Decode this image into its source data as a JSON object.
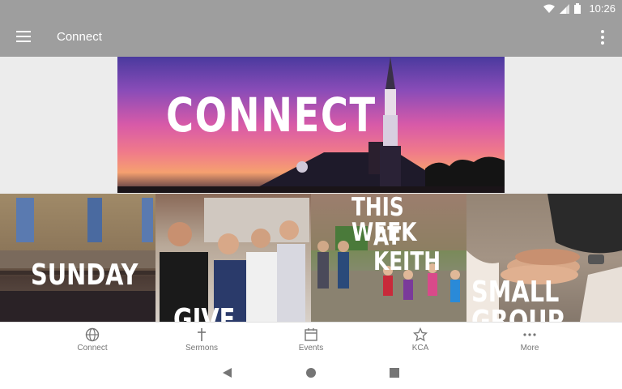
{
  "status_bar": {
    "time": "10:26",
    "icons": [
      "wifi-icon",
      "cell-signal-icon",
      "battery-icon"
    ]
  },
  "app_bar": {
    "title": "Connect",
    "left_icon": "menu-icon",
    "right_icon": "overflow-menu-icon"
  },
  "banner": {
    "title": "CONNECT"
  },
  "tiles": [
    {
      "label": "SUNDAY"
    },
    {
      "label": "GIVE"
    },
    {
      "label_line1": "THIS WEEK",
      "label_line2": "AT KEITH"
    },
    {
      "label": "SMALL GROUP"
    }
  ],
  "bottom_nav": {
    "items": [
      {
        "label": "Connect",
        "icon": "globe-icon"
      },
      {
        "label": "Sermons",
        "icon": "cross-icon"
      },
      {
        "label": "Events",
        "icon": "calendar-icon"
      },
      {
        "label": "KCA",
        "icon": "star-icon"
      },
      {
        "label": "More",
        "icon": "more-dots-icon"
      }
    ]
  },
  "system_nav": {
    "icons": [
      "back-icon",
      "home-icon",
      "recents-icon"
    ]
  },
  "colors": {
    "app_bar": "#9e9e9e",
    "nav_text": "#757575"
  }
}
